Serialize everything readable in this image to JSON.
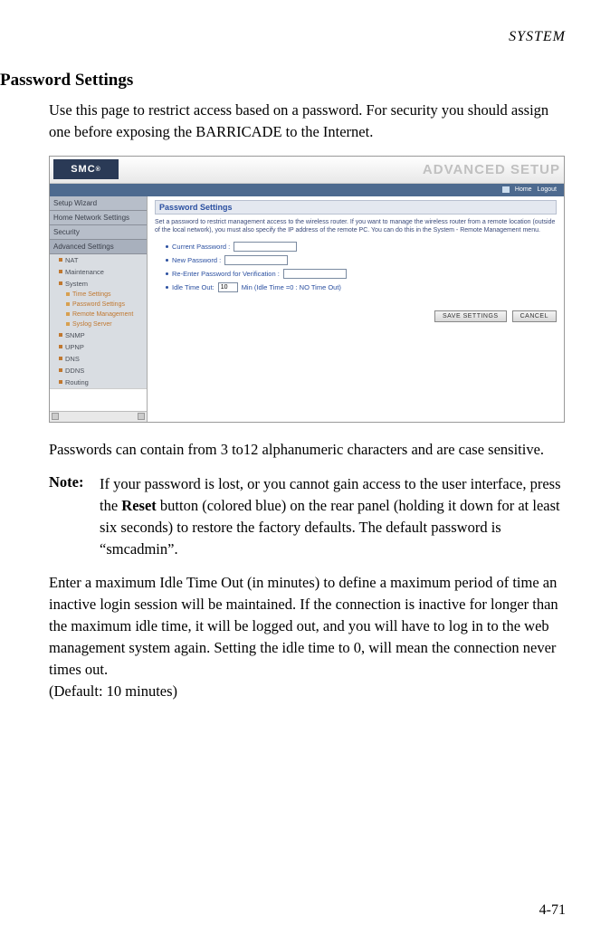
{
  "header": {
    "running": "SYSTEM"
  },
  "title": "Password Settings",
  "para1": "Use this page to restrict access based on a password. For security you should assign one before exposing the BARRICADE to the Internet.",
  "para2": "Passwords can contain from 3 to12 alphanumeric characters and are case sensitive.",
  "note_label": "Note:",
  "note_body_pre": "If your password is lost, or you cannot gain access to the user interface, press the ",
  "note_bold": "Reset",
  "note_body_post": " button (colored blue) on the rear panel (holding it down for at least six seconds) to restore the factory defaults. The default password is “smcadmin”.",
  "para3": "Enter a maximum Idle Time Out (in minutes) to define a maximum period of time an inactive login session will be maintained. If the connection is inactive for longer than the maximum idle time, it will be logged out, and you will have to log in to the web management system again. Setting the idle time to 0, will mean the connection never times out.",
  "para3_default": "(Default: 10 minutes)",
  "page_num": "4-71",
  "shot": {
    "logo": "SMC",
    "logo_r": "®",
    "adv": "ADVANCED SETUP",
    "top_home": "Home",
    "top_logout": "Logout",
    "sidebar": {
      "main": [
        "Setup Wizard",
        "Home Network Settings",
        "Security",
        "Advanced Settings"
      ],
      "subs": [
        "NAT",
        "Maintenance",
        "System"
      ],
      "sys_children": [
        "Time Settings",
        "Password Settings",
        "Remote Management",
        "Syslog Server"
      ],
      "subs2": [
        "SNMP",
        "UPNP",
        "DNS",
        "DDNS",
        "Routing"
      ]
    },
    "panel": {
      "title": "Password Settings",
      "desc": "Set a password to restrict management access to the wireless router. If you want to manage the wireless router from a remote location (outside of the local network), you must also specify the IP address of the remote PC. You can do this in the System - Remote Management menu.",
      "current_label": "Current Password :",
      "new_label": "New Password :",
      "verify_label": "Re-Enter Password for Verification :",
      "idle_label_pre": "Idle Time Out:",
      "idle_value": "10",
      "idle_label_post": "Min (Idle Time =0 : NO Time Out)",
      "save_btn": "SAVE SETTINGS",
      "cancel_btn": "CANCEL"
    }
  }
}
